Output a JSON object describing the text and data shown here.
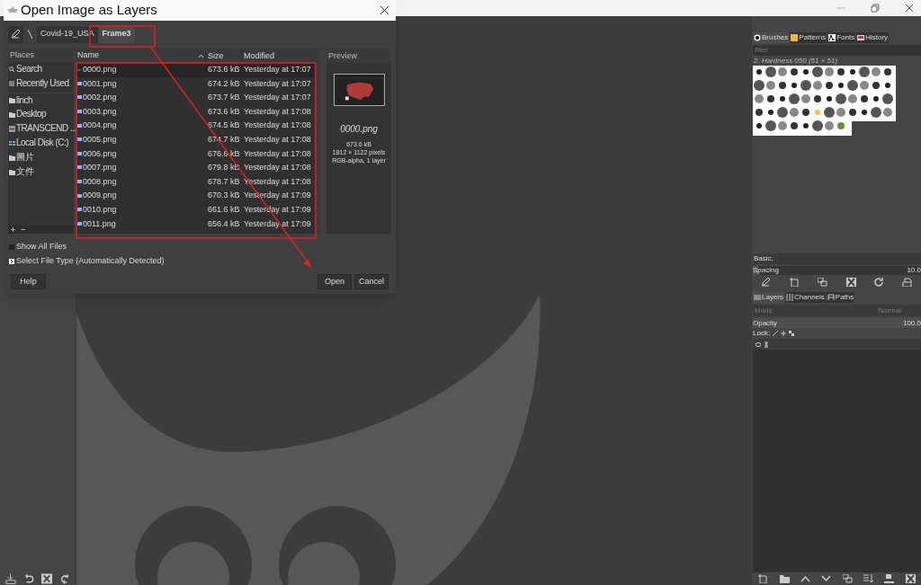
{
  "dialog": {
    "title": "Open Image as Layers",
    "path": [
      {
        "label": "Covid-19_USA",
        "selected": false
      },
      {
        "label": "Frame3",
        "selected": true
      }
    ],
    "places": {
      "header": "Places",
      "items": [
        {
          "label": "Search",
          "kind": "search"
        },
        {
          "label": "Recently Used",
          "kind": "recent"
        },
        {
          "label": "linch",
          "kind": "folder"
        },
        {
          "label": "Desktop",
          "kind": "folder"
        },
        {
          "label": "TRANSCEND ...",
          "kind": "drive"
        },
        {
          "label": "Local Disk (C:)",
          "kind": "disk"
        },
        {
          "label": "圖片",
          "kind": "folder"
        },
        {
          "label": "文件",
          "kind": "folder"
        }
      ]
    },
    "columns": [
      "Name",
      "Size",
      "Modified"
    ],
    "files": [
      {
        "name": "0000.png",
        "size": "673.6 kB",
        "modified": "Yesterday at 17:07",
        "selected": true
      },
      {
        "name": "0001.png",
        "size": "674.2 kB",
        "modified": "Yesterday at 17:07",
        "selected": false
      },
      {
        "name": "0002.png",
        "size": "673.7 kB",
        "modified": "Yesterday at 17:07",
        "selected": false
      },
      {
        "name": "0003.png",
        "size": "673.6 kB",
        "modified": "Yesterday at 17:08",
        "selected": false
      },
      {
        "name": "0004.png",
        "size": "674.5 kB",
        "modified": "Yesterday at 17:08",
        "selected": false
      },
      {
        "name": "0005.png",
        "size": "674.7 kB",
        "modified": "Yesterday at 17:08",
        "selected": false
      },
      {
        "name": "0006.png",
        "size": "676.6 kB",
        "modified": "Yesterday at 17:08",
        "selected": false
      },
      {
        "name": "0007.png",
        "size": "679.8 kB",
        "modified": "Yesterday at 17:08",
        "selected": false
      },
      {
        "name": "0008.png",
        "size": "678.7 kB",
        "modified": "Yesterday at 17:08",
        "selected": false
      },
      {
        "name": "0009.png",
        "size": "670.3 kB",
        "modified": "Yesterday at 17:09",
        "selected": false
      },
      {
        "name": "0010.png",
        "size": "661.6 kB",
        "modified": "Yesterday at 17:09",
        "selected": false
      },
      {
        "name": "0011.png",
        "size": "656.4 kB",
        "modified": "Yesterday at 17:09",
        "selected": false
      }
    ],
    "preview": {
      "header": "Preview",
      "filename": "0000.png",
      "size": "673.6 kB",
      "dimensions": "1812 × 1122 pixels",
      "type": "RGB-alpha, 1 layer"
    },
    "show_all_files": {
      "label": "Show All Files",
      "checked": false
    },
    "file_type": {
      "label": "Select File Type (Automatically Detected)",
      "expanded": false
    },
    "buttons": [
      "Help",
      "Open",
      "Cancel"
    ]
  },
  "dock": {
    "tabs": [
      {
        "label": "Brushes",
        "selected": true
      },
      {
        "label": "Patterns",
        "selected": false
      },
      {
        "label": "Fonts",
        "selected": false
      },
      {
        "label": "History",
        "selected": false
      }
    ],
    "filter_placeholder": "filter",
    "brush_name": "2. Hardness 050 (51 × 51)",
    "tag": "Basic,",
    "spacing": {
      "label": "Spacing",
      "value": "10.0",
      "level": 0.03
    },
    "layer_tabs": [
      {
        "label": "Layers",
        "selected": true
      },
      {
        "label": "Channels",
        "selected": false
      },
      {
        "label": "Paths",
        "selected": false
      }
    ],
    "mode_label": "Mode",
    "mode_value": "Normal",
    "opacity": {
      "label": "Opacity",
      "value": "100.0",
      "level": 1
    },
    "lock_label": "Lock:"
  }
}
